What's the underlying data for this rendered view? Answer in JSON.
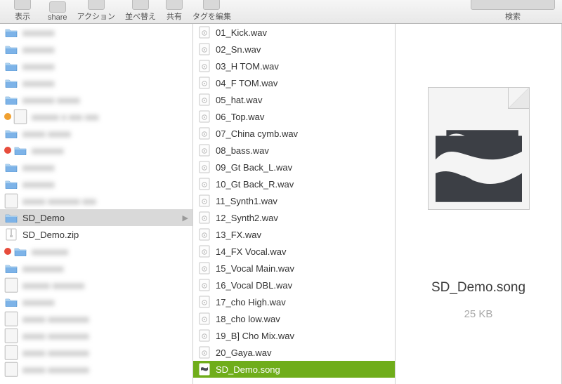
{
  "toolbar": {
    "view": "表示",
    "share": "share",
    "action": "アクション",
    "arrange": "並べ替え",
    "share2": "共有",
    "tags": "タグを編集",
    "search": "検索"
  },
  "col1": {
    "selected_index": 11,
    "items": [
      {
        "kind": "folder",
        "blurred": true,
        "t": "xxxxxxx"
      },
      {
        "kind": "folder",
        "blurred": true,
        "t": "xxxxxxx"
      },
      {
        "kind": "folder",
        "blurred": true,
        "t": "xxxxxxx"
      },
      {
        "kind": "folder",
        "blurred": true,
        "t": "xxxxxxx"
      },
      {
        "kind": "folder",
        "blurred": true,
        "t": "xxxxxxx xxxxx"
      },
      {
        "kind": "doc",
        "blurred": true,
        "tag": "#f0a030",
        "t": "xxxxxx x xxx xxx"
      },
      {
        "kind": "folder",
        "blurred": true,
        "t": "xxxxx xxxxx"
      },
      {
        "kind": "folder",
        "blurred": true,
        "tag": "#e74c3c",
        "t": "xxxxxxx"
      },
      {
        "kind": "folder",
        "blurred": true,
        "t": "xxxxxxx"
      },
      {
        "kind": "folder",
        "blurred": true,
        "t": "xxxxxxx"
      },
      {
        "kind": "doc",
        "blurred": true,
        "t": "xxxxx xxxxxxx xxx"
      },
      {
        "kind": "folder",
        "blurred": false,
        "t": "SD_Demo",
        "selected": true,
        "arrow": true
      },
      {
        "kind": "zip",
        "blurred": false,
        "t": "SD_Demo.zip"
      },
      {
        "kind": "folder",
        "blurred": true,
        "tag": "#e74c3c",
        "t": "xxxxxxxx"
      },
      {
        "kind": "folder",
        "blurred": true,
        "t": "xxxxxxxxx"
      },
      {
        "kind": "doc",
        "blurred": true,
        "t": "xxxxxx xxxxxxx"
      },
      {
        "kind": "folder",
        "blurred": true,
        "t": "xxxxxxx"
      },
      {
        "kind": "doc",
        "blurred": true,
        "t": "xxxxx  xxxxxxxxx"
      },
      {
        "kind": "doc",
        "blurred": true,
        "t": "xxxxx  xxxxxxxxx"
      },
      {
        "kind": "doc",
        "blurred": true,
        "t": "xxxxx  xxxxxxxxx"
      },
      {
        "kind": "doc",
        "blurred": true,
        "t": "xxxxx  xxxxxxxxx"
      }
    ]
  },
  "col2": {
    "items": [
      {
        "kind": "audio",
        "t": "01_Kick.wav"
      },
      {
        "kind": "audio",
        "t": "02_Sn.wav"
      },
      {
        "kind": "audio",
        "t": "03_H TOM.wav"
      },
      {
        "kind": "audio",
        "t": "04_F TOM.wav"
      },
      {
        "kind": "audio",
        "t": "05_hat.wav"
      },
      {
        "kind": "audio",
        "t": "06_Top.wav"
      },
      {
        "kind": "audio",
        "t": "07_China cymb.wav"
      },
      {
        "kind": "audio",
        "t": "08_bass.wav"
      },
      {
        "kind": "audio",
        "t": "09_Gt Back_L.wav"
      },
      {
        "kind": "audio",
        "t": "10_Gt Back_R.wav"
      },
      {
        "kind": "audio",
        "t": "11_Synth1.wav"
      },
      {
        "kind": "audio",
        "t": "12_Synth2.wav"
      },
      {
        "kind": "audio",
        "t": "13_FX.wav"
      },
      {
        "kind": "audio",
        "t": "14_FX Vocal.wav"
      },
      {
        "kind": "audio",
        "t": "15_Vocal Main.wav"
      },
      {
        "kind": "audio",
        "t": "16_Vocal DBL.wav"
      },
      {
        "kind": "audio",
        "t": "17_cho High.wav"
      },
      {
        "kind": "audio",
        "t": "18_cho low.wav"
      },
      {
        "kind": "audio",
        "t": "19_B] Cho Mix.wav"
      },
      {
        "kind": "audio",
        "t": "20_Gaya.wav"
      },
      {
        "kind": "song",
        "t": "SD_Demo.song",
        "selected": true
      }
    ]
  },
  "preview": {
    "filename": "SD_Demo.song",
    "size": "25 KB"
  }
}
